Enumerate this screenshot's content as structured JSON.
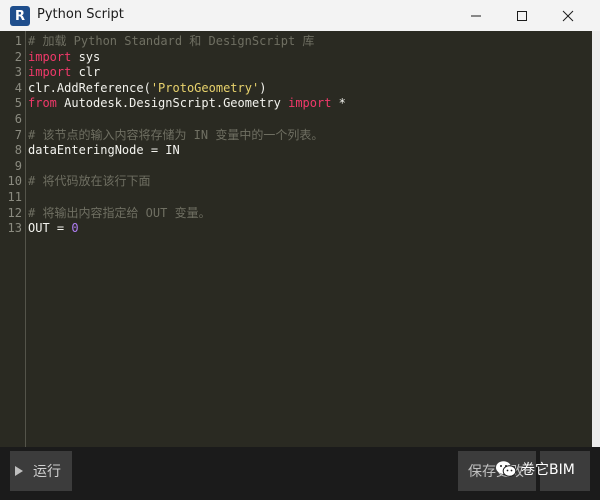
{
  "window": {
    "title": "Python Script",
    "icon_letter": "R",
    "icons": {
      "app": "revit-logo-icon",
      "minimize": "minimize-icon",
      "maximize": "maximize-icon",
      "close": "close-icon"
    }
  },
  "editor": {
    "line_numbers": [
      "1",
      "2",
      "3",
      "4",
      "5",
      "6",
      "7",
      "8",
      "9",
      "10",
      "11",
      "12",
      "13"
    ],
    "lines": [
      [
        {
          "t": "# 加载 Python Standard 和 DesignScript 库",
          "c": "comment"
        }
      ],
      [
        {
          "t": "import",
          "c": "kw"
        },
        {
          "t": " sys",
          "c": "plain"
        }
      ],
      [
        {
          "t": "import",
          "c": "kw"
        },
        {
          "t": " clr",
          "c": "plain"
        }
      ],
      [
        {
          "t": "clr.AddReference(",
          "c": "plain"
        },
        {
          "t": "'ProtoGeometry'",
          "c": "str"
        },
        {
          "t": ")",
          "c": "plain"
        }
      ],
      [
        {
          "t": "from",
          "c": "kw"
        },
        {
          "t": " Autodesk.DesignScript.Geometry ",
          "c": "plain"
        },
        {
          "t": "import",
          "c": "kw"
        },
        {
          "t": " *",
          "c": "plain"
        }
      ],
      [],
      [
        {
          "t": "# 该节点的输入内容将存储为 IN 变量中的一个列表。",
          "c": "comment"
        }
      ],
      [
        {
          "t": "dataEnteringNode = IN",
          "c": "plain"
        }
      ],
      [],
      [
        {
          "t": "# 将代码放在该行下面",
          "c": "comment"
        }
      ],
      [],
      [
        {
          "t": "# 将输出内容指定给 OUT 变量。",
          "c": "comment"
        }
      ],
      [
        {
          "t": "OUT = ",
          "c": "plain"
        },
        {
          "t": "0",
          "c": "num"
        }
      ]
    ],
    "colors": {
      "background": "#2a2a22",
      "keyword": "#f0396a",
      "string": "#e8d26c",
      "number": "#b07ef5",
      "comment": "#6f6f62",
      "text": "#f3f3ee"
    }
  },
  "footer": {
    "run_label": "运行",
    "run_icon": "play-icon",
    "save_label": "保存更改",
    "watermark_text": "卷它BIM",
    "watermark_icon": "wechat-logo-icon"
  }
}
